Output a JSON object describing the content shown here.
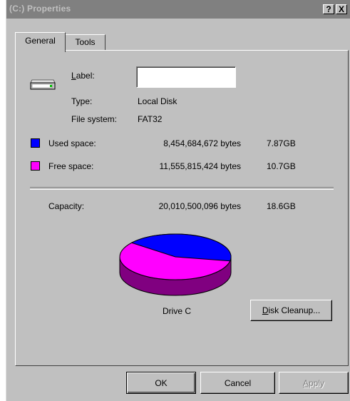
{
  "window": {
    "title": "(C:) Properties",
    "help_glyph": "?",
    "close_glyph": "X"
  },
  "tabs": [
    {
      "label": "General",
      "selected": true
    },
    {
      "label": "Tools",
      "selected": false
    }
  ],
  "general": {
    "drive_icon": "hard-drive-icon",
    "label_caption": "Label:",
    "label_value": "",
    "type_caption": "Type:",
    "type_value": "Local Disk",
    "fs_caption": "File system:",
    "fs_value": "FAT32",
    "used": {
      "caption": "Used space:",
      "bytes": "8,454,684,672 bytes",
      "size": "7.87GB",
      "color": "#0000ff"
    },
    "free": {
      "caption": "Free space:",
      "bytes": "11,555,815,424 bytes",
      "size": "10.7GB",
      "color": "#ff00ff"
    },
    "capacity": {
      "caption": "Capacity:",
      "bytes": "20,010,500,096 bytes",
      "size": "18.6GB"
    },
    "pie": {
      "used_fraction": 0.4225,
      "used_color": "#0000ff",
      "free_color": "#ff00ff",
      "free_side_color": "#800080",
      "used_side_color": "#000080"
    },
    "drive_caption": "Drive C",
    "cleanup_button": "Disk Cleanup..."
  },
  "footer": {
    "ok": "OK",
    "cancel": "Cancel",
    "apply": "Apply"
  }
}
